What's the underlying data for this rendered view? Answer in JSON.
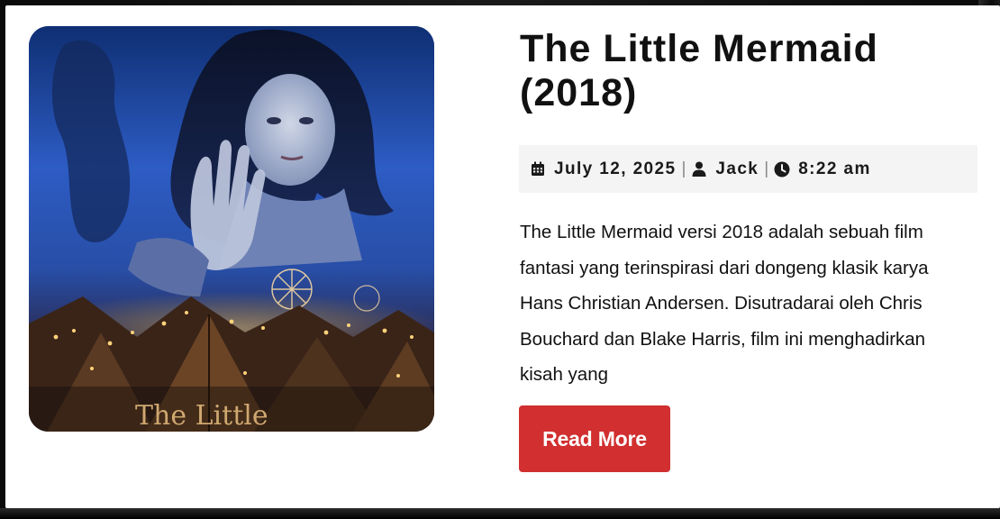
{
  "post": {
    "title": "The Little Mermaid (2018)",
    "meta": {
      "date": "July 12, 2025",
      "separator": "|",
      "author": "Jack",
      "time": "8:22 am",
      "date_icon": "calendar-icon",
      "author_icon": "user-icon",
      "time_icon": "clock-icon"
    },
    "excerpt": "The Little Mermaid versi 2018 adalah sebuah film fantasi yang terinspirasi dari dongeng klasik karya Hans Christian Andersen. Disutradarai oleh Chris Bouchard dan Blake Harris, film ini menghadirkan kisah yang",
    "read_more_label": "Read More",
    "thumbnail": {
      "poster_text": "The Little"
    }
  },
  "colors": {
    "accent": "#d12f30",
    "meta_background": "#f4f4f4",
    "text": "#111111",
    "card_background": "#ffffff"
  }
}
